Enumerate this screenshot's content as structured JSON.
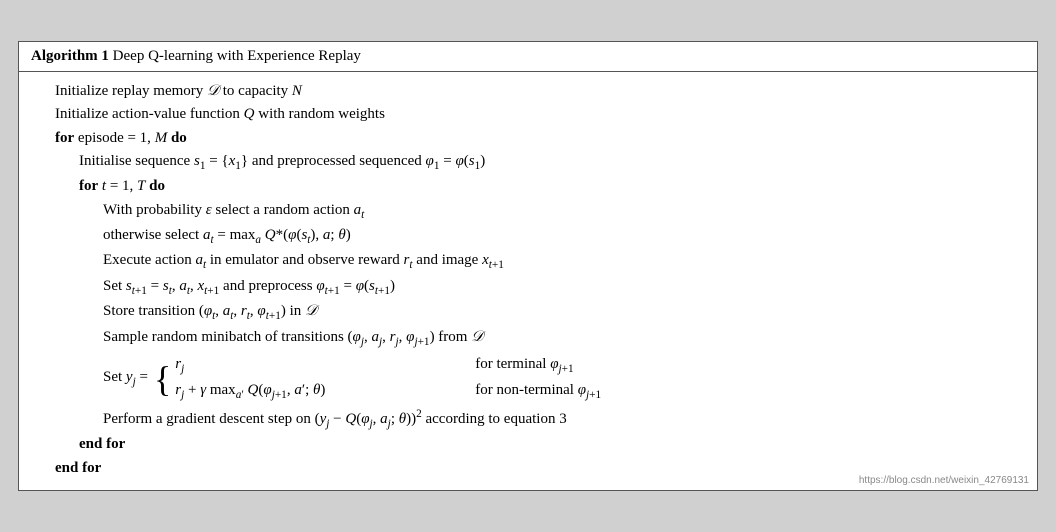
{
  "algorithm": {
    "title_bold": "Algorithm 1",
    "title_rest": " Deep Q-learning with Experience Replay",
    "lines": [
      {
        "id": "line1",
        "indent": 1,
        "text": "Initialize replay memory 𝒟 to capacity N"
      },
      {
        "id": "line2",
        "indent": 1,
        "text": "Initialize action-value function Q with random weights"
      },
      {
        "id": "line3",
        "indent": 1,
        "bold_part": "for",
        "rest": " episode = 1, M "
      },
      {
        "id": "line4",
        "indent": 2,
        "text": "Initialise sequence s₁ = {x₁} and preprocessed sequenced φ₁ = φ(s₁)"
      },
      {
        "id": "line5",
        "indent": 2,
        "bold_part": "for",
        "rest": " t = 1, T "
      },
      {
        "id": "line6",
        "indent": 3,
        "text": "With probability ε select a random action aₜ"
      },
      {
        "id": "line7",
        "indent": 3,
        "text": "otherwise select aₜ = maxₐ Q*(φ(sₜ), a; θ)"
      },
      {
        "id": "line8",
        "indent": 3,
        "text": "Execute action aₜ in emulator and observe reward rₜ and image xₜ₊₁"
      },
      {
        "id": "line9",
        "indent": 3,
        "text": "Set sₜ₊₁ = sₜ, aₜ, xₜ₊₁ and preprocess φₜ₊₁ = φ(sₜ₊₁)"
      },
      {
        "id": "line10",
        "indent": 3,
        "text": "Store transition (φₜ, aₜ, rₜ, φₜ₊₁) in 𝒟"
      },
      {
        "id": "line11",
        "indent": 3,
        "text": "Sample random minibatch of transitions (φⱼ, aⱼ, rⱼ, φⱼ₊₁) from 𝒟"
      },
      {
        "id": "line12_label",
        "text": "Set yⱼ ="
      },
      {
        "id": "line12_case1_formula",
        "text": "rⱼ"
      },
      {
        "id": "line12_case1_cond",
        "text": "for terminal φⱼ₊₁"
      },
      {
        "id": "line12_case2_formula",
        "text": "rⱼ + γ maxₐ′ Q(φⱼ₊₁, a′; θ)"
      },
      {
        "id": "line12_case2_cond",
        "text": "for non-terminal φⱼ₊₁"
      },
      {
        "id": "line13",
        "indent": 3,
        "text": "Perform a gradient descent step on (yⱼ − Q(φⱼ, aⱼ; θ))² according to equation 3"
      },
      {
        "id": "line14",
        "indent": 2,
        "bold_part": "end for",
        "rest": ""
      },
      {
        "id": "line15",
        "indent": 1,
        "bold_part": "end for",
        "rest": ""
      }
    ],
    "watermark": "https://blog.csdn.net/weixin_42769131"
  }
}
